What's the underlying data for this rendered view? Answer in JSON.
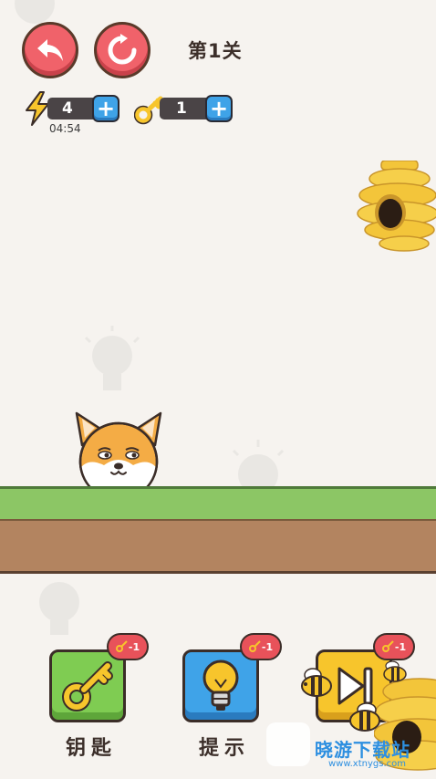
{
  "level": {
    "title": "第1关"
  },
  "resources": {
    "energy": {
      "icon": "lightning-icon",
      "value": "4",
      "timer": "04:54"
    },
    "keys": {
      "icon": "key-icon",
      "value": "1"
    }
  },
  "actions": {
    "key": {
      "label": "钥匙",
      "icon": "key-icon",
      "cost": "-1"
    },
    "hint": {
      "label": "提示",
      "icon": "lightbulb-icon",
      "cost": "-1"
    },
    "skip": {
      "icon": "skip-icon",
      "cost": "-1"
    }
  },
  "watermark": {
    "text": "晓游下载站",
    "url": "www.xtnygs.com"
  },
  "colors": {
    "background": "#f6f3ef",
    "grass": "#8cc665",
    "dirt": "#b38460",
    "red_button": "#f0626a",
    "blue_button": "#3fa3e8",
    "green_button": "#7fcc52",
    "yellow_button": "#f7c52c",
    "hive": "#f3c53a"
  }
}
